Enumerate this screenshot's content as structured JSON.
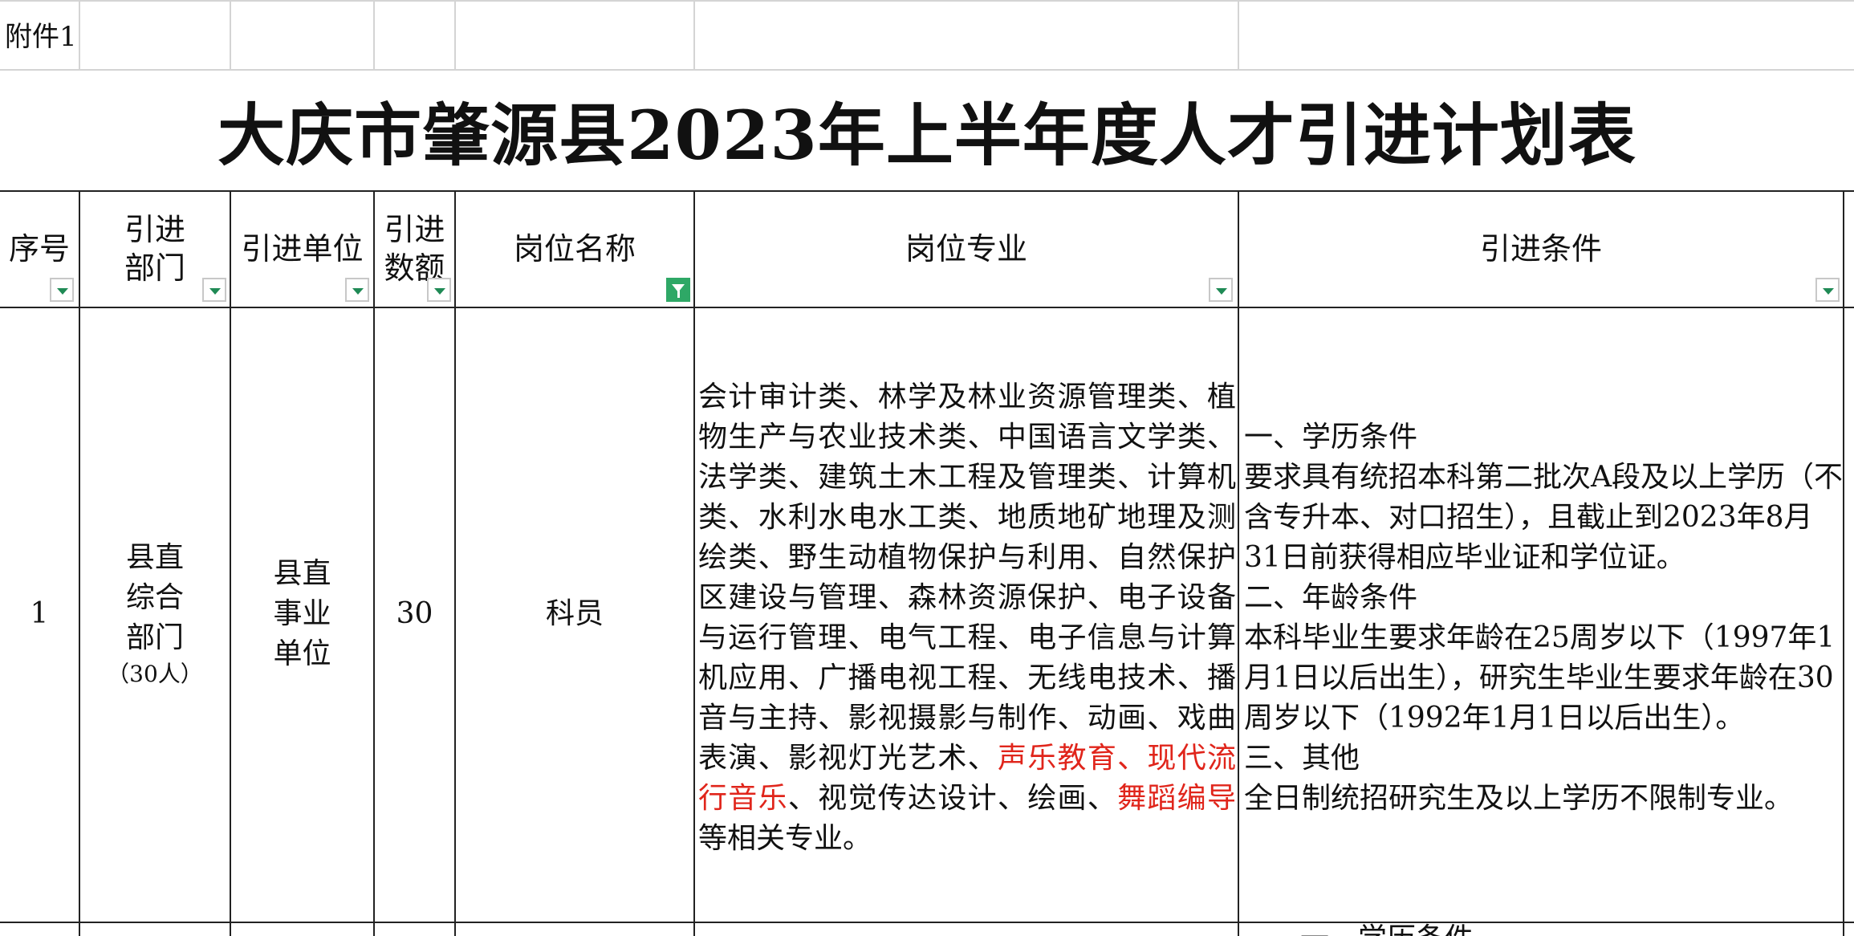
{
  "annex_label": "附件1",
  "title": "大庆市肇源县2023年上半年度人才引进计划表",
  "headers": {
    "seq": "序号",
    "dept_l1": "引进",
    "dept_l2": "部门",
    "unit": "引进单位",
    "quota_l1": "引进",
    "quota_l2": "数额",
    "position": "岗位名称",
    "major": "岗位专业",
    "conditions": "引进条件"
  },
  "row1": {
    "seq": "1",
    "dept_lines": [
      "县直",
      "综合",
      "部门"
    ],
    "dept_count": "（30人）",
    "unit_lines": [
      "县直",
      "事业",
      "单位"
    ],
    "quota": "30",
    "position": "科员",
    "major_before_red1": "会计审计类、林学及林业资源管理类、植物生产与农业技术类、中国语言文学类、法学类、建筑土木工程及管理类、计算机类、水利水电水工类、地质地矿地理及测绘类、野生动植物保护与利用、自然保护区建设与管理、森林资源保护、电子设备与运行管理、电气工程、电子信息与计算机应用、广播电视工程、无线电技术、播音与主持、影视摄影与制作、动画、戏曲表演、影视灯光艺术、",
    "major_red1": "声乐教育、现代流行音乐",
    "major_middle": "、视觉传达设计、绘画、",
    "major_red2": "舞蹈编导",
    "major_after": "等相关专业。",
    "conditions_lines": [
      "一、学历条件",
      "要求具有统招本科第二批次A段及以上学历（不含专升本、对口招生），且截止到2023年8月31日前获得相应毕业证和学位证。",
      "二、年龄条件",
      "本科毕业生要求年龄在25周岁以下（1997年1月1日以后出生），研究生毕业生要求年龄在30周岁以下（1992年1月1日以后出生）。",
      "三、其他",
      "全日制统招研究生及以上学历不限制专业。"
    ]
  },
  "row2_partial": {
    "conditions_first_line": "一、学历条件"
  },
  "colors": {
    "highlight_red": "#e0251b",
    "filter_green": "#2ea866"
  }
}
